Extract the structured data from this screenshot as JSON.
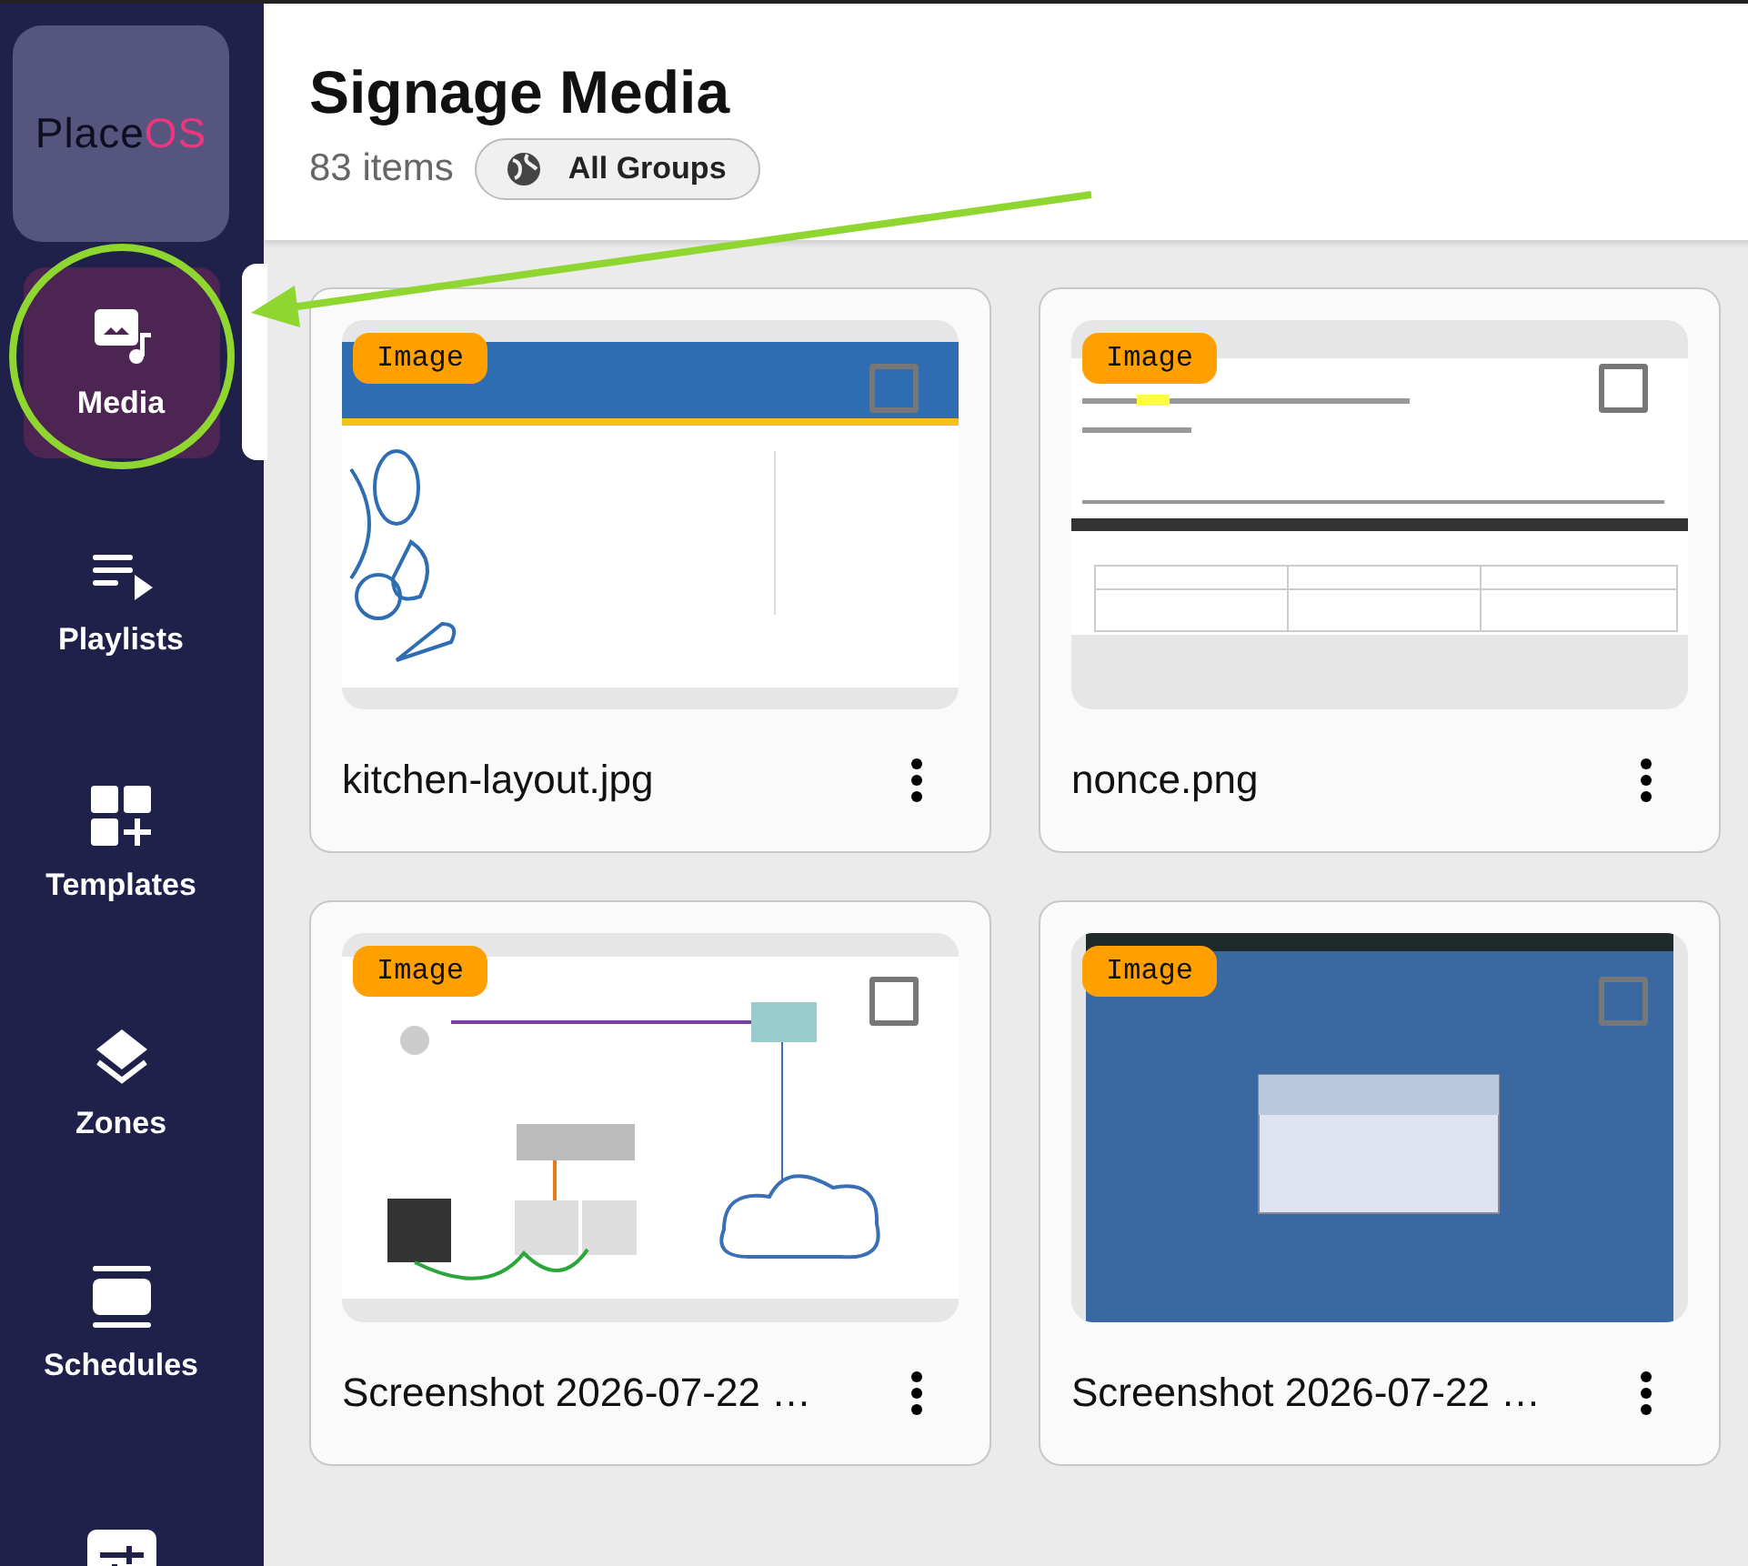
{
  "logo": {
    "text": "Place",
    "accent": "OS"
  },
  "nav": [
    {
      "label": "Media",
      "selected": true
    },
    {
      "label": "Playlists",
      "selected": false
    },
    {
      "label": "Templates",
      "selected": false
    },
    {
      "label": "Zones",
      "selected": false
    },
    {
      "label": "Schedules",
      "selected": false
    },
    {
      "selected": false
    }
  ],
  "header": {
    "title": "Signage Media",
    "count": "83 items",
    "group_button": "All Groups"
  },
  "media": [
    {
      "name": "kitchen-layout.jpg",
      "type": "Image",
      "kind": "kitchen",
      "checked": false
    },
    {
      "name": "nonce.png",
      "type": "Image",
      "kind": "document",
      "checked": false
    },
    {
      "name": "Screenshot 2026-07-22 …",
      "type": "Image",
      "kind": "diagram",
      "checked": false
    },
    {
      "name": "Screenshot 2026-07-22 …",
      "type": "Image",
      "kind": "desktop",
      "checked": false
    }
  ]
}
